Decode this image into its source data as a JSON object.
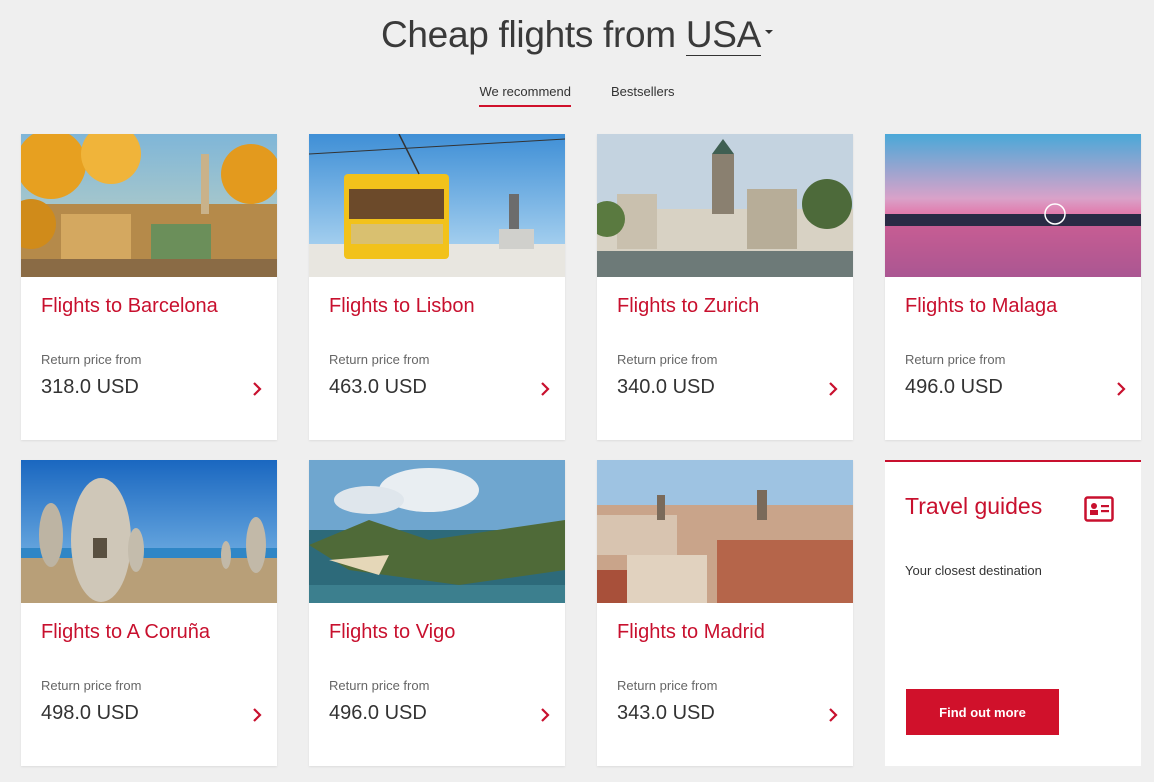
{
  "header": {
    "title_prefix": "Cheap flights from ",
    "country": "USA"
  },
  "tabs": [
    {
      "label": "We recommend",
      "active": true
    },
    {
      "label": "Bestsellers",
      "active": false
    }
  ],
  "cards": [
    {
      "destination": "Flights to Barcelona",
      "price_label": "Return price from",
      "price": "318.0 USD"
    },
    {
      "destination": "Flights to Lisbon",
      "price_label": "Return price from",
      "price": "463.0 USD"
    },
    {
      "destination": "Flights to Zurich",
      "price_label": "Return price from",
      "price": "340.0 USD"
    },
    {
      "destination": "Flights to Malaga",
      "price_label": "Return price from",
      "price": "496.0 USD"
    },
    {
      "destination": "Flights to A Coruña",
      "price_label": "Return price from",
      "price": "498.0 USD"
    },
    {
      "destination": "Flights to Vigo",
      "price_label": "Return price from",
      "price": "496.0 USD"
    },
    {
      "destination": "Flights to Madrid",
      "price_label": "Return price from",
      "price": "343.0 USD"
    }
  ],
  "guide": {
    "title": "Travel guides",
    "subtitle": "Your closest destination",
    "button_label": "Find out more",
    "icon": "id-card-icon"
  },
  "colors": {
    "accent": "#c8102e",
    "button": "#d0112b",
    "background": "#efefef"
  }
}
